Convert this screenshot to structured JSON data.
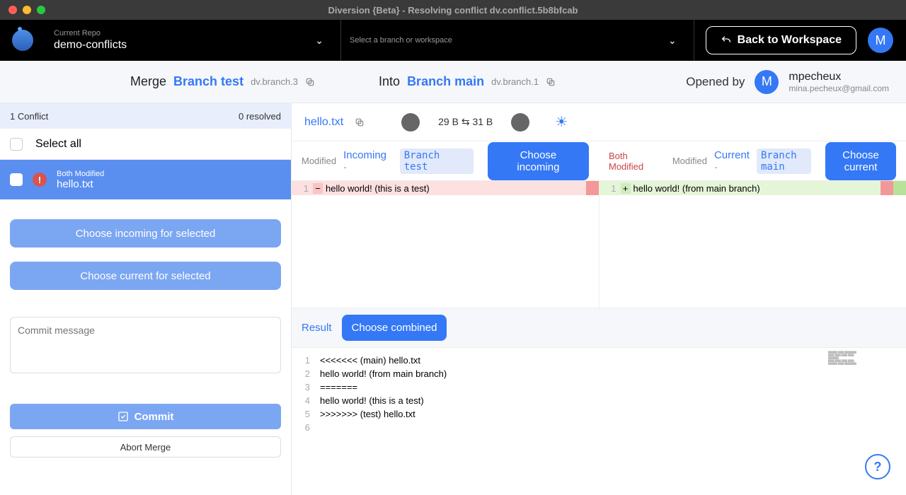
{
  "window": {
    "title": "Diversion {Beta} - Resolving conflict dv.conflict.5b8bfcab"
  },
  "topnav": {
    "repo_label": "Current Repo",
    "repo_name": "demo-conflicts",
    "branch_placeholder": "Select a branch or workspace",
    "back_label": "Back to Workspace",
    "avatar_letter": "M"
  },
  "mergebar": {
    "merge_label": "Merge",
    "source_branch": "Branch test",
    "source_id": "dv.branch.3",
    "into_label": "Into",
    "target_branch": "Branch main",
    "target_id": "dv.branch.1",
    "opened_by_label": "Opened by",
    "user_initial": "M",
    "user_name": "mpecheux",
    "user_email": "mina.pecheux@gmail.com"
  },
  "leftpanel": {
    "conflict_count": "1 Conflict",
    "resolved_count": "0 resolved",
    "select_all": "Select all",
    "file": {
      "status": "Both Modified",
      "name": "hello.txt"
    },
    "choose_incoming_btn": "Choose incoming for selected",
    "choose_current_btn": "Choose current for selected",
    "commit_placeholder": "Commit message",
    "commit_btn": "Commit",
    "abort_btn": "Abort Merge"
  },
  "rightpanel": {
    "file_name": "hello.txt",
    "size_left": "29 B",
    "size_right": "31 B",
    "incoming": {
      "modified_label": "Modified",
      "title": "Incoming",
      "branch": "Branch test",
      "choose_btn": "Choose incoming",
      "line_num": "1",
      "content": "hello world! (this is a test)"
    },
    "current": {
      "both_modified": "Both Modified",
      "modified_label": "Modified",
      "title": "Current",
      "branch": "Branch main",
      "choose_btn": "Choose current",
      "line_num": "1",
      "content": "hello world! (from main branch)"
    },
    "result": {
      "label": "Result",
      "choose_combined": "Choose combined",
      "lines": [
        "<<<<<<< (main) hello.txt",
        "hello world! (from main branch)",
        "=======",
        "hello world! (this is a test)",
        ">>>>>>> (test) hello.txt",
        ""
      ]
    }
  }
}
